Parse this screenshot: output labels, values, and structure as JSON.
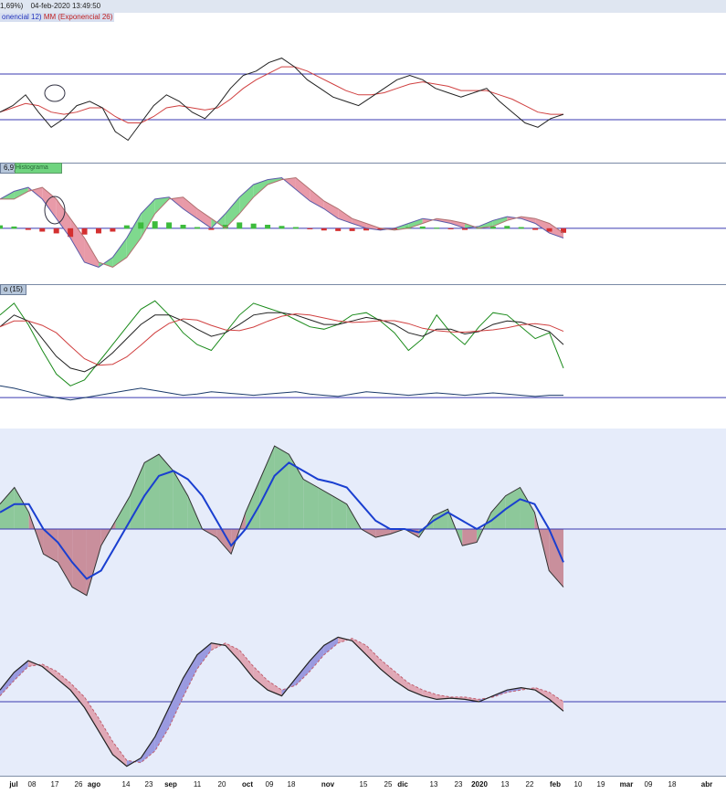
{
  "header": {
    "change_text": "1,69%)",
    "datetime": "04-feb-2020 13:49:50",
    "legend_a": "onencial 12)",
    "legend_b": "MM (Exponencial 26)"
  },
  "panels": {
    "macd_tag": "6,9)",
    "macd_tag2": "Histograma",
    "stoch_tag": "o (15)"
  },
  "colors": {
    "price": "#222222",
    "avg": "#d04040",
    "hline": "#3a3ab0",
    "green_fill": "#7fd98e",
    "red_fill": "#e89aa8",
    "blue_line": "#1a3fd0",
    "green_line": "#1a8a1a",
    "navy_line": "#1a3a6a"
  },
  "axis": {
    "ticks": [
      "jul",
      "08",
      "17",
      "26",
      "ago",
      "14",
      "23",
      "sep",
      "11",
      "20",
      "oct",
      "09",
      "18",
      "nov",
      "15",
      "25",
      "dic",
      "13",
      "23",
      "2020",
      "13",
      "22",
      "feb",
      "10",
      "19",
      "mar",
      "09",
      "18",
      "abr"
    ]
  },
  "chart_data": [
    {
      "type": "line",
      "title": "",
      "series": [
        {
          "name": "",
          "values": [
            55,
            58,
            63,
            55,
            48,
            52,
            58,
            60,
            57,
            46,
            42,
            50,
            58,
            63,
            60,
            55,
            52,
            58,
            66,
            72,
            74,
            78,
            80,
            76,
            70,
            66,
            62,
            60,
            58,
            62,
            66,
            70,
            72,
            70,
            66,
            64,
            62,
            64,
            66,
            60,
            55,
            50,
            48,
            52,
            54
          ]
        },
        {
          "name": "MM (Exponencial 26)",
          "values": [
            55,
            57,
            59,
            58,
            55,
            54,
            55,
            57,
            57,
            53,
            50,
            50,
            53,
            57,
            58,
            57,
            56,
            57,
            61,
            66,
            70,
            73,
            76,
            76,
            74,
            71,
            68,
            65,
            63,
            63,
            64,
            66,
            68,
            69,
            68,
            67,
            65,
            65,
            65,
            63,
            61,
            58,
            55,
            54,
            54
          ]
        }
      ]
    },
    {
      "type": "area",
      "title": "",
      "series": [
        {
          "name": "",
          "values": [
            30,
            38,
            42,
            30,
            10,
            -10,
            -35,
            -40,
            -30,
            -10,
            15,
            30,
            32,
            20,
            10,
            0,
            15,
            32,
            45,
            50,
            52,
            40,
            28,
            20,
            10,
            5,
            0,
            -2,
            0,
            5,
            10,
            8,
            5,
            0,
            2,
            8,
            12,
            10,
            5,
            -5,
            -10
          ]
        },
        {
          "name": "Histograma",
          "values": [
            5,
            3,
            -2,
            -5,
            -8,
            -14,
            -10,
            -8,
            -5,
            5,
            10,
            12,
            10,
            6,
            2,
            -2,
            6,
            10,
            8,
            6,
            4,
            2,
            -1,
            -3,
            -4,
            -4,
            -3,
            -2,
            -1,
            2,
            3,
            1,
            -1,
            -2,
            1,
            3,
            4,
            2,
            -2,
            -5,
            -7
          ]
        }
      ]
    },
    {
      "type": "line",
      "title": "",
      "series": [
        {
          "name": "",
          "values": [
            70,
            80,
            62,
            40,
            20,
            10,
            15,
            30,
            45,
            60,
            75,
            82,
            70,
            55,
            45,
            40,
            55,
            70,
            80,
            76,
            72,
            66,
            60,
            58,
            62,
            70,
            72,
            65,
            55,
            40,
            50,
            70,
            55,
            45,
            60,
            72,
            70,
            60,
            50,
            55,
            25
          ]
        },
        {
          "name": "",
          "values": [
            60,
            70,
            65,
            50,
            35,
            25,
            22,
            28,
            38,
            50,
            62,
            70,
            70,
            65,
            58,
            52,
            55,
            62,
            70,
            72,
            72,
            70,
            66,
            62,
            62,
            65,
            68,
            66,
            62,
            55,
            52,
            58,
            58,
            54,
            56,
            62,
            65,
            64,
            60,
            56,
            45
          ]
        },
        {
          "name": "",
          "values": [
            10,
            8,
            5,
            2,
            0,
            -2,
            0,
            2,
            4,
            6,
            8,
            6,
            4,
            2,
            3,
            5,
            4,
            3,
            2,
            3,
            4,
            5,
            3,
            2,
            1,
            3,
            5,
            4,
            3,
            2,
            3,
            4,
            3,
            2,
            3,
            4,
            3,
            2,
            1,
            2,
            2
          ]
        }
      ]
    },
    {
      "type": "area",
      "title": "",
      "series": [
        {
          "name": "",
          "values": [
            15,
            25,
            10,
            -15,
            -20,
            -35,
            -40,
            -10,
            5,
            20,
            40,
            45,
            35,
            20,
            0,
            -5,
            -15,
            10,
            30,
            50,
            45,
            30,
            25,
            20,
            15,
            0,
            -5,
            -3,
            0,
            -5,
            8,
            12,
            -10,
            -8,
            10,
            20,
            25,
            10,
            -25,
            -35
          ]
        },
        {
          "name": "",
          "values": [
            10,
            15,
            15,
            0,
            -8,
            -20,
            -30,
            -25,
            -10,
            5,
            20,
            32,
            35,
            30,
            20,
            5,
            -10,
            0,
            15,
            32,
            40,
            35,
            30,
            28,
            25,
            15,
            5,
            0,
            0,
            -2,
            5,
            10,
            5,
            0,
            5,
            12,
            18,
            15,
            0,
            -20
          ]
        }
      ]
    },
    {
      "type": "area",
      "title": "",
      "series": [
        {
          "name": "",
          "values": [
            10,
            25,
            35,
            30,
            20,
            10,
            -5,
            -25,
            -45,
            -55,
            -48,
            -30,
            -5,
            20,
            40,
            50,
            48,
            35,
            20,
            10,
            5,
            20,
            35,
            48,
            55,
            52,
            40,
            28,
            18,
            10,
            5,
            2,
            3,
            2,
            0,
            5,
            10,
            12,
            10,
            2,
            -8
          ]
        },
        {
          "name": "",
          "values": [
            5,
            18,
            30,
            32,
            26,
            16,
            4,
            -14,
            -34,
            -50,
            -52,
            -42,
            -22,
            4,
            28,
            44,
            50,
            44,
            30,
            18,
            10,
            14,
            26,
            40,
            50,
            54,
            48,
            36,
            26,
            16,
            10,
            6,
            4,
            4,
            2,
            4,
            8,
            10,
            12,
            8,
            0
          ]
        }
      ]
    }
  ]
}
